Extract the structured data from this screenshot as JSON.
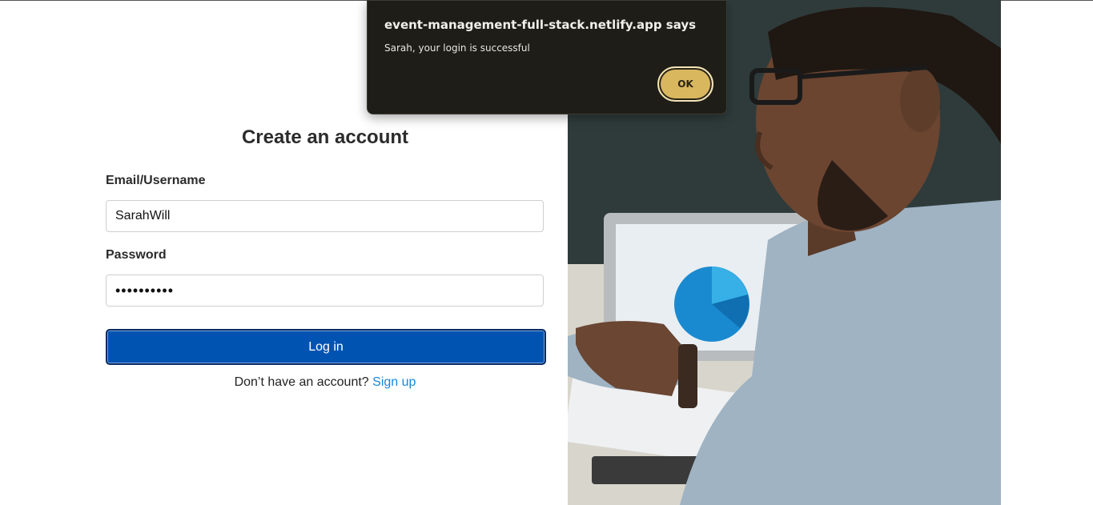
{
  "dialog": {
    "origin": "event-management-full-stack.netlify.app says",
    "message": "Sarah, your login is successful",
    "ok_label": "OK"
  },
  "form": {
    "title": "Create an account",
    "email_label": "Email/Username",
    "email_value": "SarahWill",
    "password_label": "Password",
    "password_value": "••••••••••",
    "login_label": "Log in",
    "signup_prompt": "Don’t have an account?",
    "signup_link": "Sign up"
  },
  "colors": {
    "primary_button": "#0153b2",
    "link": "#1a86d8",
    "dialog_bg": "#1f1d17",
    "ok_button": "#d9b75f"
  }
}
